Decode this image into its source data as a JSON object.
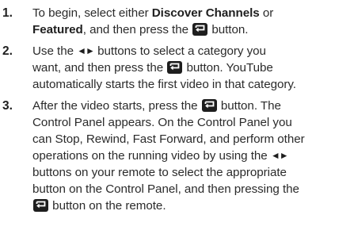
{
  "steps": [
    {
      "number": "1.",
      "l1_a": "To begin, select either ",
      "l1_b": "Discover Channels",
      "l1_c": " or",
      "l2_a": "Featured",
      "l2_b": ", and then press the ",
      "l2_c": " button."
    },
    {
      "number": "2.",
      "l1_a": "Use the ",
      "l1_b": " buttons to select a category you",
      "l2_a": "want, and then press the ",
      "l2_b": " button. YouTube",
      "l3": "automatically starts the first video in that category."
    },
    {
      "number": "3.",
      "l1_a": "After the video starts, press the ",
      "l1_b": " button. The",
      "l2": "Control Panel appears. On the Control Panel you",
      "l3": "can Stop, Rewind, Fast Forward, and perform other",
      "l4_a": "operations on the running video by using the ",
      "l5": "buttons on your remote to select the appropriate",
      "l6": "button on the Control Panel, and then pressing the",
      "l7_b": " button on the remote."
    }
  ],
  "icons": {
    "enter": "enter-icon",
    "left_right_arrows": "◄►"
  }
}
